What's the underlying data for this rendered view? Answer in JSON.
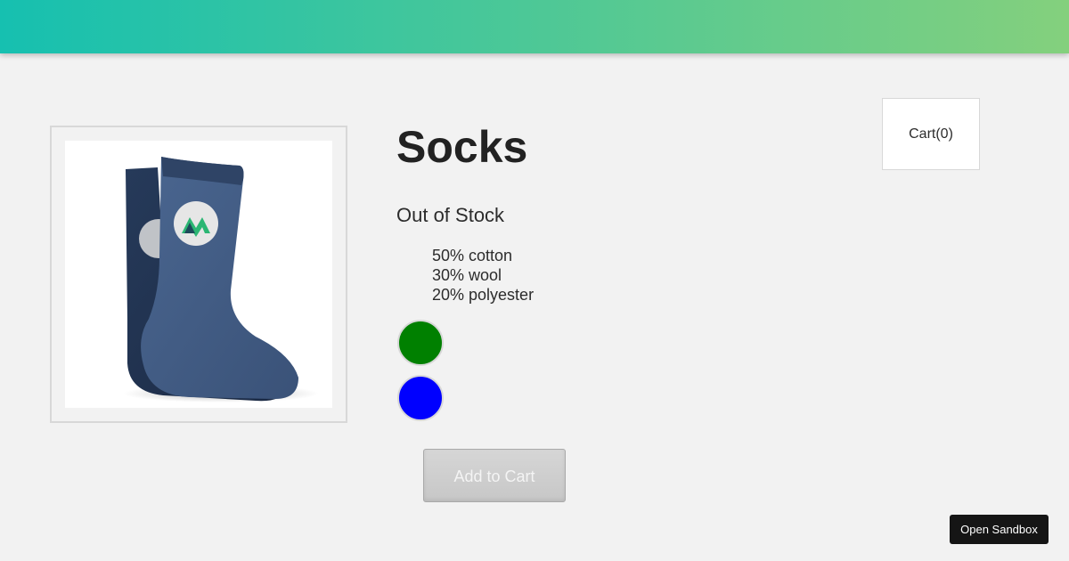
{
  "product": {
    "title": "Socks",
    "stock_status": "Out of Stock",
    "details": [
      "50% cotton",
      "30% wool",
      "20% polyester"
    ],
    "variants": [
      {
        "color_name": "green",
        "color": "#008000"
      },
      {
        "color_name": "blue",
        "color": "#0000ff"
      }
    ],
    "image_alt": "sock-image"
  },
  "cart": {
    "label": "Cart(0)",
    "add_label": "Add to Cart"
  },
  "sandbox": {
    "label": "Open Sandbox"
  },
  "colors": {
    "nav_gradient_start": "#16c0b0",
    "nav_gradient_end": "#84d07d",
    "background": "#f2f2f2"
  }
}
